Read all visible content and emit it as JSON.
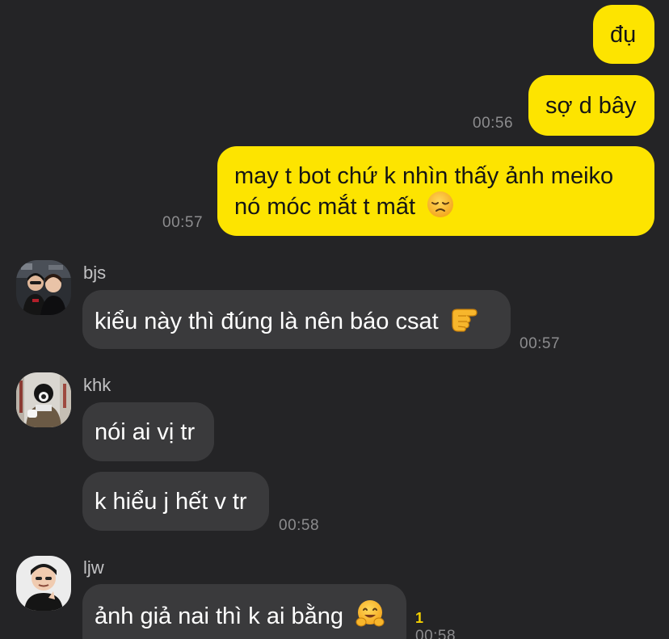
{
  "colors": {
    "background": "#242426",
    "outgoing_bubble": "#fde400",
    "incoming_bubble": "#3a3a3c",
    "timestamp": "#8c8c8e",
    "unread_count": "#f3d000"
  },
  "messages_out": [
    {
      "text": "đụ",
      "time": ""
    },
    {
      "text": "sợ d bây",
      "time": "00:56"
    },
    {
      "line1": "may t bot chứ k nhìn thấy ảnh meiko",
      "line2": "nó móc mắt t mất",
      "emoji": "disappointed-face-emoji",
      "time": "00:57"
    }
  ],
  "senders": [
    {
      "name": "bjs",
      "avatar": "photo-two-people-avatar",
      "messages": [
        {
          "text": "kiểu này thì đúng là nên báo csat",
          "emoji": "backhand-pointing-right-emoji",
          "time": "00:57"
        }
      ]
    },
    {
      "name": "khk",
      "avatar": "photo-person-outdoors-avatar",
      "messages": [
        {
          "text": "nói ai vị tr",
          "time": ""
        },
        {
          "text": "k hiểu j hết v tr",
          "time": "00:58"
        }
      ]
    },
    {
      "name": "ljw",
      "avatar": "photo-person-cartoon-avatar",
      "messages": [
        {
          "text": "ảnh giả nai thì k ai bằng",
          "emoji": "hugging-face-emoji",
          "time": "00:58",
          "unread": "1"
        }
      ]
    }
  ]
}
